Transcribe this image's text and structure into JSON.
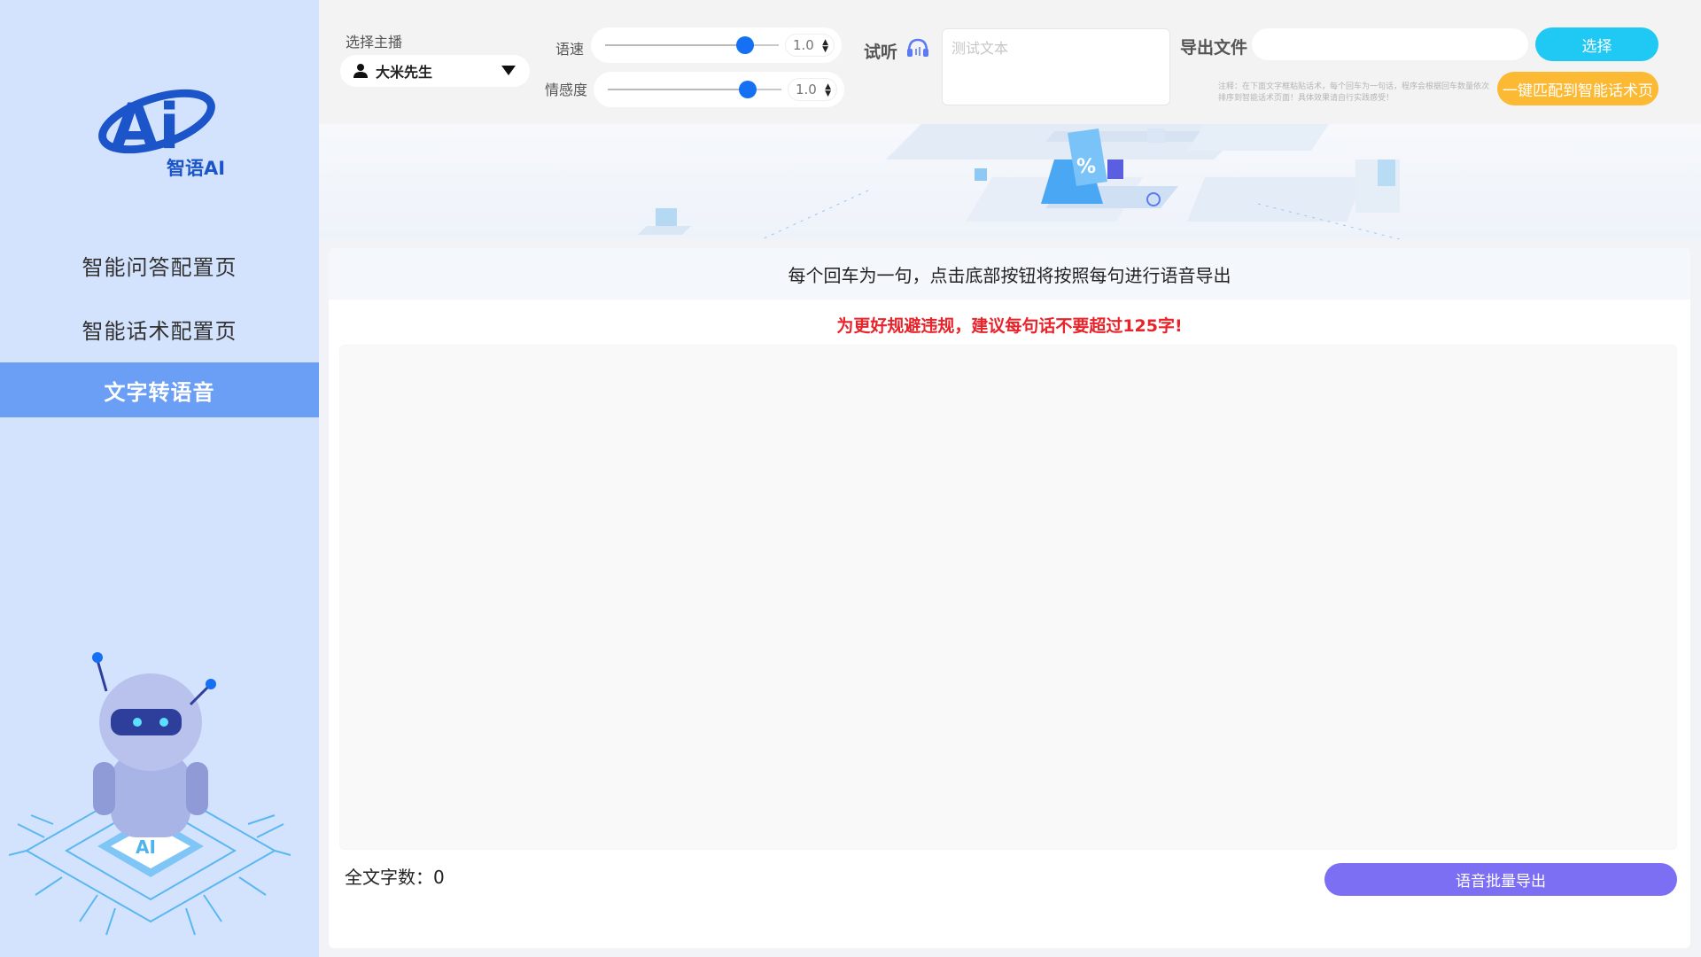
{
  "brand": {
    "name": "智语AI",
    "logo_mark": "Ai"
  },
  "sidebar": {
    "items": [
      {
        "label": "智能问答配置页",
        "active": false
      },
      {
        "label": "智能话术配置页",
        "active": false
      },
      {
        "label": "文字转语音",
        "active": true
      }
    ]
  },
  "toolbar": {
    "anchor_label": "选择主播",
    "anchor_value": "大米先生",
    "speed_label": "语速",
    "speed_value": "1.0",
    "emotion_label": "情感度",
    "emotion_value": "1.0",
    "listen_label": "试听",
    "test_placeholder": "测试文本",
    "export_label": "导出文件",
    "export_value": "",
    "choose_button": "选择",
    "note": "注释：在下面文字框粘贴话术，每个回车为一句话，程序会根据回车数量依次排序到智能话术页面！具体效果请自行实践感受！",
    "match_button": "一键匹配到智能话术页"
  },
  "main": {
    "instruction": "每个回车为一句，点击底部按钮将按照每句进行语音导出",
    "warning": "为更好规避违规，建议每句话不要超过125字!",
    "text_value": "",
    "count_label": "全文字数：",
    "count_value": "0",
    "export_button": "语音批量导出"
  },
  "colors": {
    "sidebar_bg": "#d3e3fd",
    "active_nav": "#6b9ef5",
    "slider_thumb": "#1670f3",
    "choose_button": "#20c8f4",
    "match_button": "#fbb934",
    "export_button": "#7d6ff3",
    "warning_text": "#e8232a"
  },
  "icons": {
    "anchor": "user-icon",
    "dropdown": "caret-down-icon",
    "listen": "headset-icon"
  }
}
